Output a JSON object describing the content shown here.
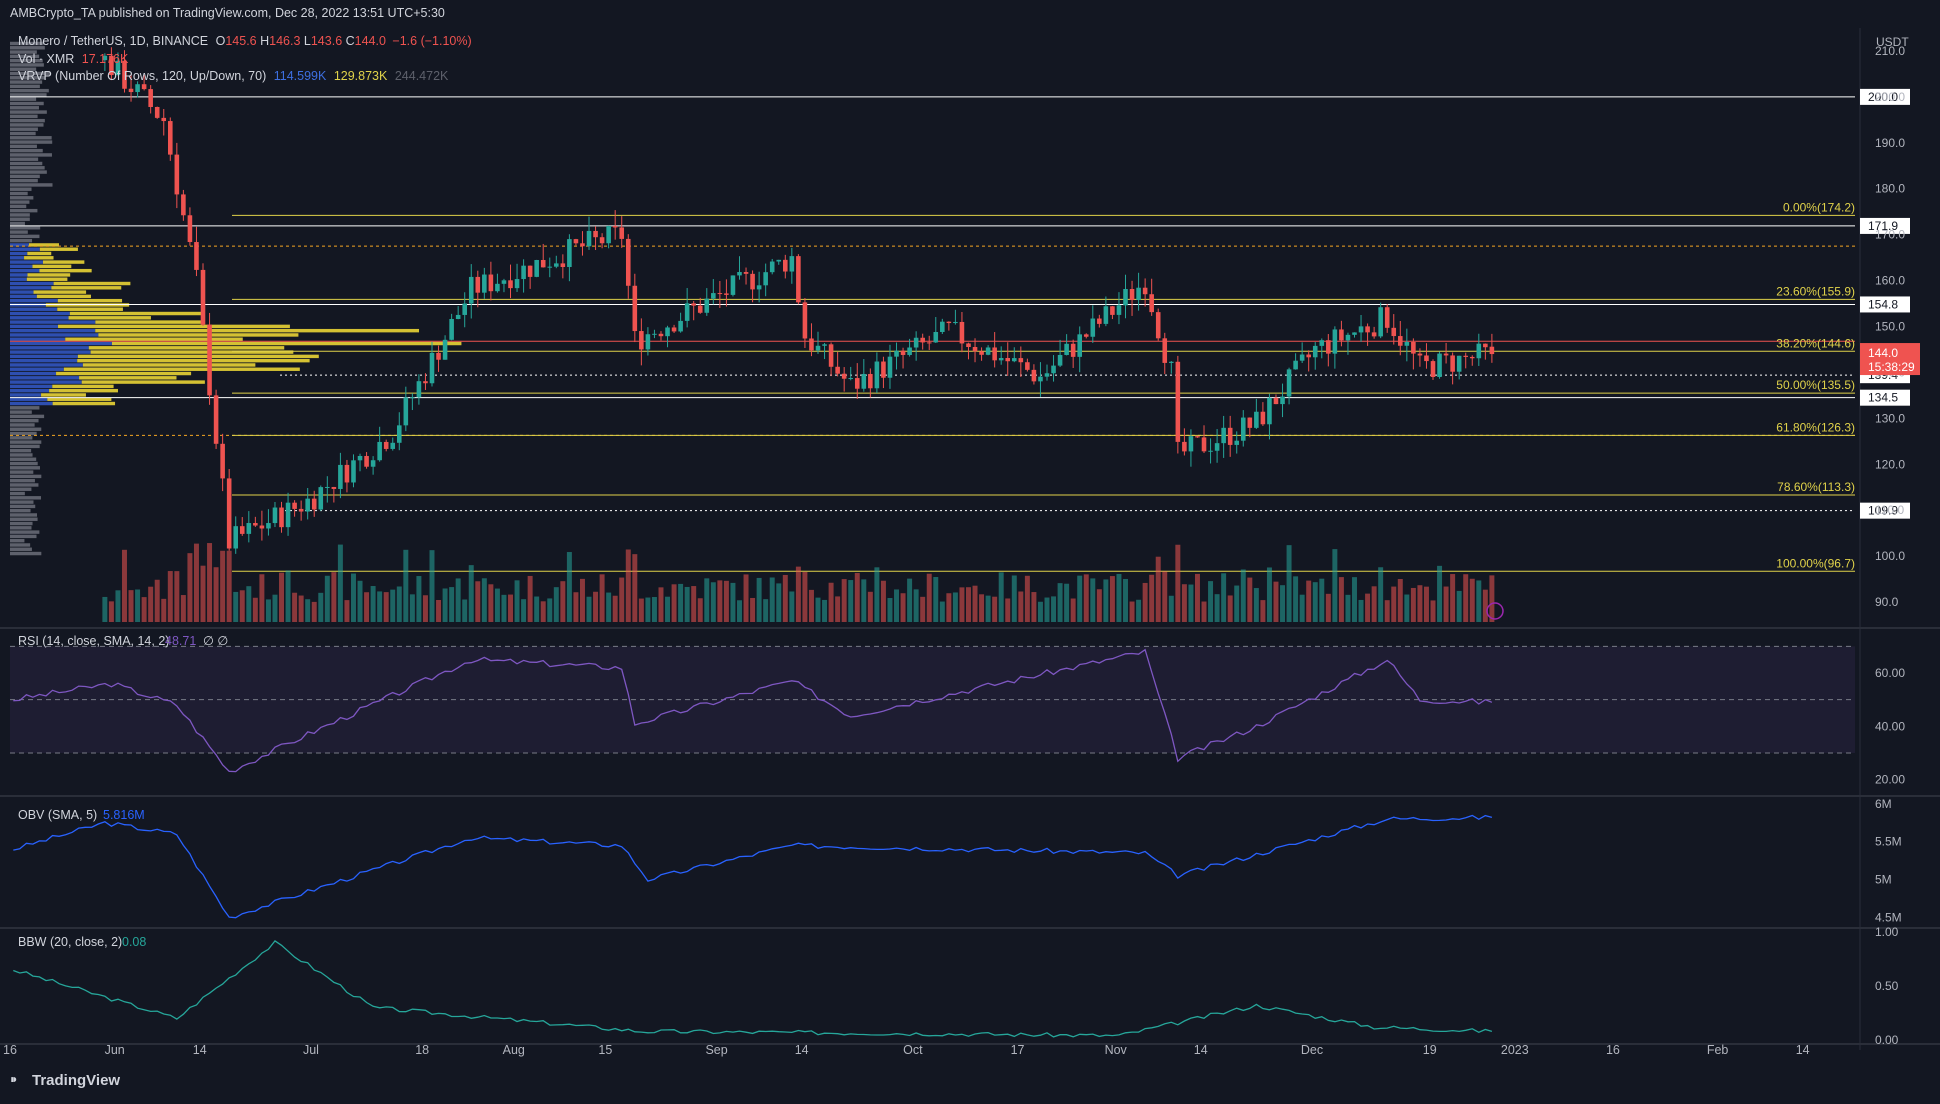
{
  "header": {
    "published": "AMBCrypto_TA published on TradingView.com, Dec 28, 2022 13:51 UTC+5:30"
  },
  "legend": {
    "symbol": "Monero / TetherUS, 1D, BINANCE",
    "o_label": "O",
    "o": "145.6",
    "h_label": "H",
    "h": "146.3",
    "l_label": "L",
    "l": "143.6",
    "c_label": "C",
    "c": "144.0",
    "change": "−1.6 (−1.10%)",
    "vol_label": "Vol · XMR",
    "vol": "17.176K",
    "vrvp_label": "VRVP (Number Of Rows, 120, Up/Down, 70)",
    "vrvp_up": "114.599K",
    "vrvp_down": "129.873K",
    "vrvp_total": "244.472K"
  },
  "currency": "USDT",
  "colors": {
    "background": "#131722",
    "up": "#26a69a",
    "down": "#ef5350",
    "fib": "#e0d24a",
    "rsi": "#7e57c2",
    "obv": "#2962ff",
    "bbw": "#26a69a",
    "vp_up": "#2e4fb0",
    "vp_down": "#d4c133",
    "vp_out": "#787b86"
  },
  "chart_data": [
    {
      "type": "candlestick",
      "title": "Monero / TetherUS, 1D, BINANCE",
      "ylim": [
        85,
        215
      ],
      "y_ticks": [
        90.0,
        100.0,
        110.0,
        120.0,
        130.0,
        140.0,
        150.0,
        160.0,
        170.0,
        180.0,
        190.0,
        200.0,
        210.0
      ],
      "x_ticks": [
        "16",
        "Jun",
        "14",
        "Jul",
        "18",
        "Aug",
        "15",
        "Sep",
        "14",
        "Oct",
        "17",
        "Nov",
        "14",
        "Dec",
        "19",
        "2023",
        "16",
        "Feb",
        "14"
      ],
      "x_range": [
        "2022-05-16",
        "2023-02-22"
      ],
      "last_price": "144.0",
      "countdown": "15:38:29",
      "key_points": [
        {
          "date": "2022-05-30",
          "price": 208
        },
        {
          "date": "2022-06-08",
          "price": 195
        },
        {
          "date": "2022-06-13",
          "price": 160
        },
        {
          "date": "2022-06-18",
          "price": 103
        },
        {
          "date": "2022-06-30",
          "price": 112
        },
        {
          "date": "2022-07-13",
          "price": 127
        },
        {
          "date": "2022-07-18",
          "price": 140
        },
        {
          "date": "2022-07-25",
          "price": 158
        },
        {
          "date": "2022-08-12",
          "price": 168
        },
        {
          "date": "2022-08-17",
          "price": 170
        },
        {
          "date": "2022-08-19",
          "price": 147
        },
        {
          "date": "2022-09-12",
          "price": 165
        },
        {
          "date": "2022-09-14",
          "price": 148
        },
        {
          "date": "2022-09-21",
          "price": 137
        },
        {
          "date": "2022-10-06",
          "price": 149
        },
        {
          "date": "2022-10-20",
          "price": 139
        },
        {
          "date": "2022-11-05",
          "price": 160
        },
        {
          "date": "2022-11-09",
          "price": 140
        },
        {
          "date": "2022-11-10",
          "price": 122
        },
        {
          "date": "2022-11-22",
          "price": 129
        },
        {
          "date": "2022-12-01",
          "price": 145
        },
        {
          "date": "2022-12-12",
          "price": 152
        },
        {
          "date": "2022-12-17",
          "price": 141
        },
        {
          "date": "2022-12-28",
          "price": 144
        }
      ],
      "levels": [
        {
          "label": "200.0",
          "value": 200.0,
          "style": "white-solid"
        },
        {
          "label": "171.9",
          "value": 171.9,
          "style": "white-solid"
        },
        {
          "label": "154.8",
          "value": 154.8,
          "style": "white-solid"
        },
        {
          "label": "139.4",
          "value": 139.4,
          "style": "white-dotted"
        },
        {
          "label": "134.5",
          "value": 134.5,
          "style": "white-solid"
        },
        {
          "label": "109.9",
          "value": 109.9,
          "style": "white-dotted"
        },
        {
          "label": "",
          "value": 167.5,
          "style": "orange-dotted"
        },
        {
          "label": "",
          "value": 126.3,
          "style": "orange-dotted"
        },
        {
          "label": "",
          "value": 146.8,
          "style": "red-solid"
        }
      ],
      "fib_levels": [
        {
          "label": "0.00%(174.2)",
          "value": 174.2
        },
        {
          "label": "23.60%(155.9)",
          "value": 155.9
        },
        {
          "label": "38.20%(144.6)",
          "value": 144.6
        },
        {
          "label": "50.00%(135.5)",
          "value": 135.5
        },
        {
          "label": "61.80%(126.3)",
          "value": 126.3
        },
        {
          "label": "78.60%(113.3)",
          "value": 113.3
        },
        {
          "label": "100.00%(96.7)",
          "value": 96.7
        }
      ]
    },
    {
      "type": "line",
      "title": "RSI (14, close, SMA, 14, 2)",
      "current_value": "48.71",
      "extra": "∅ ∅",
      "ylim": [
        15,
        75
      ],
      "y_ticks": [
        "60.00",
        "40.00",
        "20.00"
      ],
      "bands": [
        70,
        50,
        30
      ],
      "key_points": [
        {
          "date": "2022-05-16",
          "value": 50
        },
        {
          "date": "2022-05-31",
          "value": 56
        },
        {
          "date": "2022-06-10",
          "value": 48
        },
        {
          "date": "2022-06-18",
          "value": 23
        },
        {
          "date": "2022-06-30",
          "value": 37
        },
        {
          "date": "2022-07-25",
          "value": 65
        },
        {
          "date": "2022-08-17",
          "value": 62
        },
        {
          "date": "2022-08-19",
          "value": 41
        },
        {
          "date": "2022-09-12",
          "value": 57
        },
        {
          "date": "2022-09-21",
          "value": 44
        },
        {
          "date": "2022-11-05",
          "value": 68
        },
        {
          "date": "2022-11-10",
          "value": 28
        },
        {
          "date": "2022-11-22",
          "value": 40
        },
        {
          "date": "2022-12-12",
          "value": 65
        },
        {
          "date": "2022-12-17",
          "value": 50
        },
        {
          "date": "2022-12-28",
          "value": 49
        }
      ]
    },
    {
      "type": "line",
      "title": "OBV (SMA, 5)",
      "current_value": "5.816M",
      "ylim": [
        4.4,
        6.05
      ],
      "y_ticks": [
        "6M",
        "5.5M",
        "5M",
        "4.5M"
      ],
      "key_points": [
        {
          "date": "2022-05-16",
          "value": 5.4
        },
        {
          "date": "2022-05-30",
          "value": 5.75
        },
        {
          "date": "2022-06-10",
          "value": 5.6
        },
        {
          "date": "2022-06-18",
          "value": 4.5
        },
        {
          "date": "2022-07-25",
          "value": 5.55
        },
        {
          "date": "2022-08-17",
          "value": 5.45
        },
        {
          "date": "2022-08-21",
          "value": 5.0
        },
        {
          "date": "2022-09-12",
          "value": 5.45
        },
        {
          "date": "2022-11-05",
          "value": 5.35
        },
        {
          "date": "2022-11-10",
          "value": 5.05
        },
        {
          "date": "2022-12-12",
          "value": 5.8
        },
        {
          "date": "2022-12-28",
          "value": 5.82
        }
      ]
    },
    {
      "type": "line",
      "title": "BBW (20, close, 2)",
      "current_value": "0.08",
      "ylim": [
        0,
        1.0
      ],
      "y_ticks": [
        "1.00",
        "0.50",
        "0.00"
      ],
      "key_points": [
        {
          "date": "2022-05-16",
          "value": 0.65
        },
        {
          "date": "2022-06-10",
          "value": 0.2
        },
        {
          "date": "2022-06-25",
          "value": 0.9
        },
        {
          "date": "2022-07-10",
          "value": 0.3
        },
        {
          "date": "2022-08-20",
          "value": 0.08
        },
        {
          "date": "2022-10-01",
          "value": 0.06
        },
        {
          "date": "2022-11-01",
          "value": 0.04
        },
        {
          "date": "2022-11-22",
          "value": 0.32
        },
        {
          "date": "2022-12-10",
          "value": 0.12
        },
        {
          "date": "2022-12-28",
          "value": 0.08
        }
      ]
    }
  ],
  "brand": "TradingView"
}
